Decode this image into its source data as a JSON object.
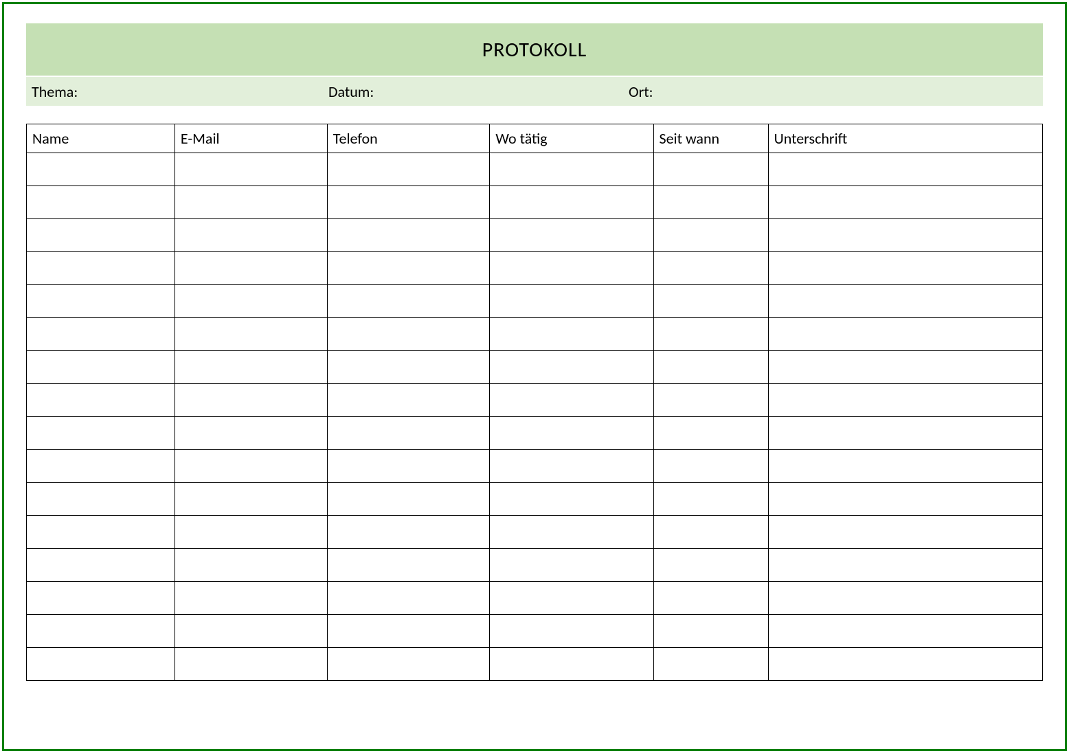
{
  "header": {
    "title": "PROTOKOLL"
  },
  "meta": {
    "theme_label": "Thema:",
    "date_label": "Datum:",
    "place_label": "Ort:"
  },
  "table": {
    "columns": [
      "Name",
      "E-Mail",
      "Telefon",
      "Wo tätig",
      "Seit wann",
      "Unterschrift"
    ],
    "rows": [
      [
        "",
        "",
        "",
        "",
        "",
        ""
      ],
      [
        "",
        "",
        "",
        "",
        "",
        ""
      ],
      [
        "",
        "",
        "",
        "",
        "",
        ""
      ],
      [
        "",
        "",
        "",
        "",
        "",
        ""
      ],
      [
        "",
        "",
        "",
        "",
        "",
        ""
      ],
      [
        "",
        "",
        "",
        "",
        "",
        ""
      ],
      [
        "",
        "",
        "",
        "",
        "",
        ""
      ],
      [
        "",
        "",
        "",
        "",
        "",
        ""
      ],
      [
        "",
        "",
        "",
        "",
        "",
        ""
      ],
      [
        "",
        "",
        "",
        "",
        "",
        ""
      ],
      [
        "",
        "",
        "",
        "",
        "",
        ""
      ],
      [
        "",
        "",
        "",
        "",
        "",
        ""
      ],
      [
        "",
        "",
        "",
        "",
        "",
        ""
      ],
      [
        "",
        "",
        "",
        "",
        "",
        ""
      ],
      [
        "",
        "",
        "",
        "",
        "",
        ""
      ],
      [
        "",
        "",
        "",
        "",
        "",
        ""
      ]
    ]
  }
}
